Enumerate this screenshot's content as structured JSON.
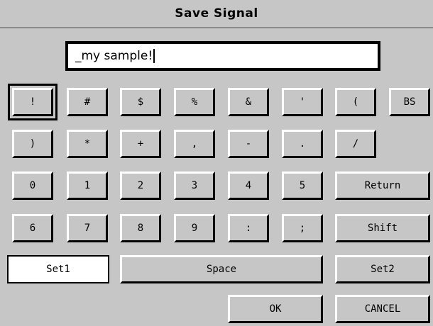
{
  "window": {
    "title": "Save Signal"
  },
  "input": {
    "value": "_my sample!"
  },
  "rows": [
    [
      "!",
      "#",
      "$",
      "%",
      "&",
      "'",
      "(",
      "BS"
    ],
    [
      ")",
      "*",
      "+",
      ",",
      "-",
      ".",
      "/"
    ],
    [
      "0",
      "1",
      "2",
      "3",
      "4",
      "5",
      "Return"
    ],
    [
      "6",
      "7",
      "8",
      "9",
      ":",
      ";",
      "Shift"
    ]
  ],
  "bottom": {
    "set1": "Set1",
    "space": "Space",
    "set2": "Set2"
  },
  "actions": {
    "ok": "OK",
    "cancel": "CANCEL"
  }
}
